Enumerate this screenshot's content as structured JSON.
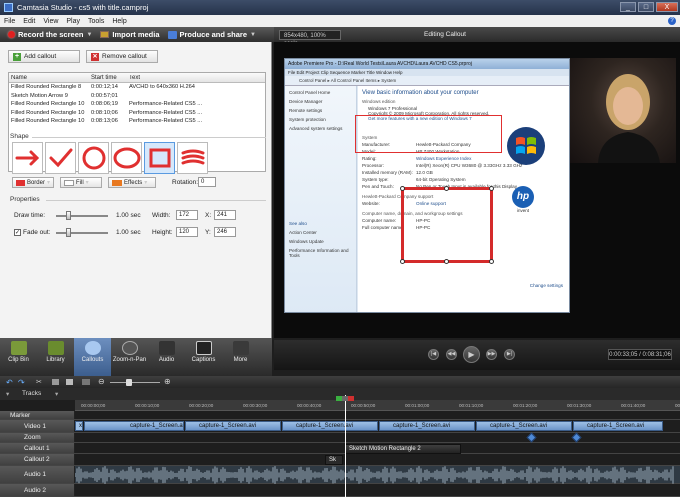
{
  "titlebar": {
    "title": "Camtasia Studio - cs5 with title.camproj",
    "min": "_",
    "max": "□",
    "close": "X"
  },
  "menu": [
    "File",
    "Edit",
    "View",
    "Play",
    "Tools",
    "Help"
  ],
  "toolbar": {
    "record": "Record the screen",
    "import": "Import media",
    "share": "Produce and share"
  },
  "canvas": {
    "zoom": "854x480, 100% scale",
    "editing": "Editing Callout"
  },
  "callouts": {
    "add_label": "Add callout",
    "remove_label": "Remove callout",
    "columns": [
      "Name",
      "Start time",
      "Text"
    ],
    "rows": [
      {
        "name": "Filled Rounded Rectangle 8",
        "start": "0:00:12;14",
        "text": "AVCHD to 640x360 H.264"
      },
      {
        "name": "Sketch Motion Arrow 9",
        "start": "0:00:57;01",
        "text": ""
      },
      {
        "name": "Filled Rounded Rectangle 10",
        "start": "0:08:06;19",
        "text": "Performance-Related CS5 ..."
      },
      {
        "name": "Filled Rounded Rectangle 10",
        "start": "0:08:10;06",
        "text": "Performance-Related CS5 ..."
      },
      {
        "name": "Filled Rounded Rectangle 10",
        "start": "0:08:13;06",
        "text": "Performance-Related CS5 ..."
      }
    ],
    "shape_label": "Shape",
    "border_label": "Border",
    "fill_label": "Fill",
    "effects_label": "Effects",
    "rotation_label": "Rotation:",
    "rotation_value": "0",
    "properties_label": "Properties",
    "draw_time_label": "Draw time:",
    "draw_time_value": "1.00 sec",
    "fade_out_label": "Fade out:",
    "fade_out_value": "1.00 sec",
    "width_label": "Width:",
    "width_value": "172",
    "height_label": "Height:",
    "height_value": "120",
    "x_label": "X:",
    "x_value": "241",
    "y_label": "Y:",
    "y_value": "246"
  },
  "screenshot": {
    "title": "Adobe Premiere Pro - D:\\Real World Tests\\Laura AVCHD\\Laura AVCHD CS5.prproj",
    "menu": "File  Edit  Project  Clip  Sequence  Marker  Title  Window  Help",
    "address": "Control Panel ▸ All Control Panel Items ▸ System",
    "left_links": [
      "Control Panel Home",
      "Device Manager",
      "Remote settings",
      "System protection",
      "Advanced system settings"
    ],
    "see_also": "See also",
    "see_also_links": [
      "Action Center",
      "Windows Update",
      "Performance Information and Tools"
    ],
    "heading": "View basic information about your computer",
    "windows_edition": "Windows edition",
    "edition": "Windows 7 Professional",
    "copyright": "Copyright © 2009 Microsoft Corporation.  All rights reserved.",
    "more_features": "Get more features with a new edition of Windows 7",
    "system_label": "System",
    "system_rows": [
      {
        "k": "Manufacturer:",
        "v": "Hewlett-Packard Company"
      },
      {
        "k": "Model:",
        "v": "HP Z400 Workstation"
      },
      {
        "k": "Rating:",
        "v": "Windows Experience Index"
      },
      {
        "k": "Processor:",
        "v": "Intel(R) Xeon(R) CPU   W3680 @ 3.33GHz  3.33 GHz"
      },
      {
        "k": "Installed memory (RAM):",
        "v": "12.0 GB"
      },
      {
        "k": "System type:",
        "v": "64-bit Operating System"
      },
      {
        "k": "Pen and Touch:",
        "v": "No Pen or Touch Input is available for this Display"
      }
    ],
    "support_label": "Hewlett-Packard Company support",
    "website_key": "Website:",
    "website_val": "Online support",
    "computer_label": "Computer name, domain, and workgroup settings",
    "computer_rows": [
      {
        "k": "Computer name:",
        "v": "HP-PC"
      },
      {
        "k": "Full computer name:",
        "v": "HP-PC"
      }
    ],
    "change_settings": "Change settings",
    "hp_logo": "hp",
    "hp_sub": "invent"
  },
  "player": {
    "timecode": "0:00:33;05 / 0:08:31;06"
  },
  "tasks": [
    "Clip Bin",
    "Library",
    "Callouts",
    "Zoom-n-Pan",
    "Audio",
    "Captions",
    "More"
  ],
  "timeline": {
    "tracks_label": "Tracks",
    "ticks": [
      "00:00:00;00",
      "00:00:10;00",
      "00:00:20;00",
      "00:00:30;00",
      "00:00:40;00",
      "00:00:50;00",
      "00:01:00;00",
      "00:01:10;00",
      "00:01:20;00",
      "00:01:30;00",
      "00:01:40;00",
      "00:01:50;00"
    ],
    "track_names": [
      "Marker",
      "Video 1",
      "Zoom",
      "Callout 1",
      "Callout 2",
      "Audio 1",
      "Audio 2"
    ],
    "clip_label": "capture-1_Screen.avi",
    "first_clip": "xed",
    "callout_clip": "Sketch Motion Rectangle 2",
    "callout_small": "Sk"
  },
  "colors": {
    "accent": "#e03030",
    "selection": "#3399ff"
  }
}
